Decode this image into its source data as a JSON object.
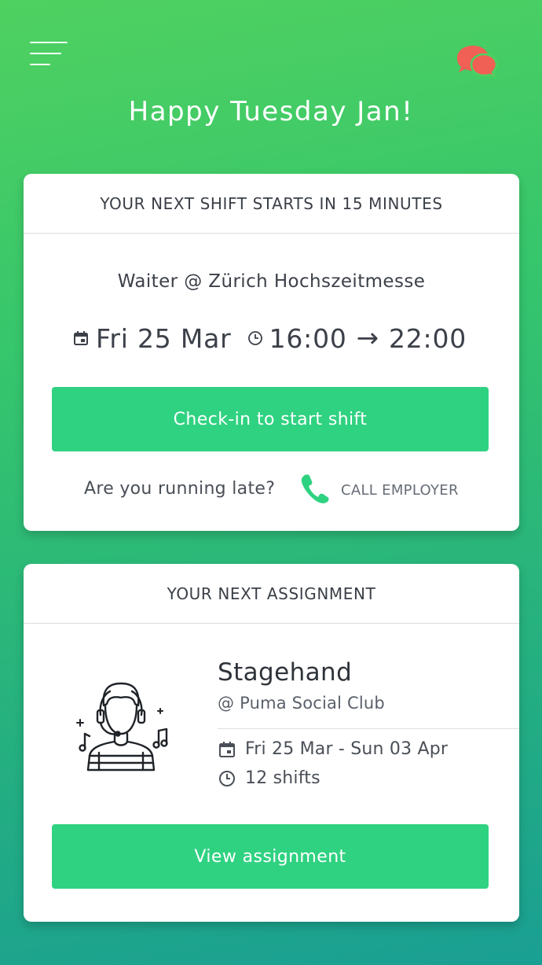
{
  "header": {
    "menu_icon": "hamburger-menu-icon",
    "chat_icon": "chat-bubbles-icon",
    "greeting": "Happy Tuesday Jan!"
  },
  "next_shift": {
    "heading": "YOUR NEXT SHIFT STARTS IN 15 MINUTES",
    "title": "Waiter @ Zürich Hochszeitmesse",
    "date": "Fri 25 Mar",
    "start": "16:00",
    "arrow": "→",
    "end": "22:00",
    "checkin_label": "Check-in to start shift",
    "late_question": "Are you running late?",
    "call_label": "CALL EMPLOYER"
  },
  "next_assignment": {
    "heading": "YOUR NEXT ASSIGNMENT",
    "role": "Stagehand",
    "venue": "@ Puma Social Club",
    "dates": "Fri 25 Mar - Sun 03 Apr",
    "shifts": "12 shifts",
    "view_label": "View assignment"
  },
  "colors": {
    "accent_green": "#2fd281",
    "chat_icon_red": "#f06055",
    "text_dark": "#3c4049"
  }
}
